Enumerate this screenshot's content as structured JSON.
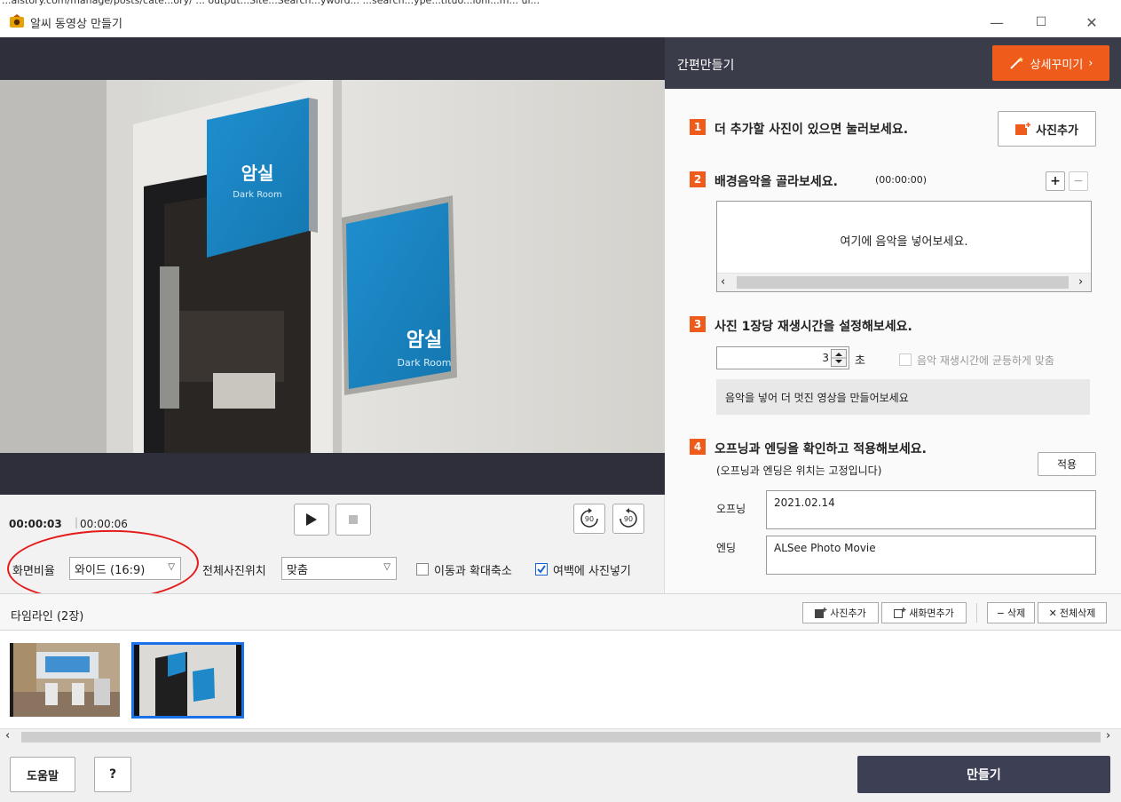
{
  "window": {
    "url_fragment": "...aistory.com/manage/posts/cate...ory/ ... output...Site...Search...yword... ...search...ype...tituo...ioni...m... ui...",
    "title": "알씨 동영상 만들기",
    "minimize": "—",
    "maximize": "☐",
    "close": "✕"
  },
  "preview": {
    "sign_title": "암실",
    "sign_subtitle": "Dark Room"
  },
  "controls": {
    "time_current": "00:00:03",
    "time_total": "00:00:06",
    "rotate_right": "90",
    "rotate_left": "90",
    "aspect_label": "화면비율",
    "aspect_value": "와이드 (16:9)",
    "position_label": "전체사진위치",
    "position_value": "맞춤",
    "move_zoom_label": "이동과 확대축소",
    "move_zoom_checked": false,
    "margin_fill_label": "여백에 사진넣기",
    "margin_fill_checked": true
  },
  "right_panel": {
    "title": "간편만들기",
    "detail_button": "상세꾸미기",
    "step1": {
      "num": "1",
      "title": "더 추가할 사진이 있으면 눌러보세요.",
      "button": "사진추가"
    },
    "step2": {
      "num": "2",
      "title": "배경음악을 골라보세요.",
      "duration": "(00:00:00)",
      "placeholder": "여기에 음악을 넣어보세요.",
      "add": "+",
      "remove": "−"
    },
    "step3": {
      "num": "3",
      "title": "사진 1장당 재생시간을 설정해보세요.",
      "seconds": "3",
      "unit": "초",
      "fit_music_label": "음악 재생시간에 균등하게 맞춤",
      "hint": "음악을 넣어 더 멋진 영상을 만들어보세요"
    },
    "step4": {
      "num": "4",
      "title": "오프닝과 엔딩을 확인하고 적용해보세요.",
      "subtitle": "(오프닝과 엔딩은 위치는 고정입니다)",
      "apply": "적용",
      "opening_label": "오프닝",
      "opening_value": "2021.02.14",
      "ending_label": "엔딩",
      "ending_value": "ALSee Photo Movie"
    }
  },
  "timeline": {
    "label": "타임라인 (2장)",
    "add_photo": "사진추가",
    "add_screen": "새화면추가",
    "delete": "삭제",
    "delete_all": "전체삭제"
  },
  "bottom": {
    "help": "도움말",
    "question": "?",
    "make": "만들기"
  },
  "colors": {
    "accent": "#ee5b1b",
    "header_dark": "#3b3c4a",
    "make_button": "#3d3f55",
    "selection_blue": "#1b72e8",
    "annotation_red": "#e41a1a"
  }
}
